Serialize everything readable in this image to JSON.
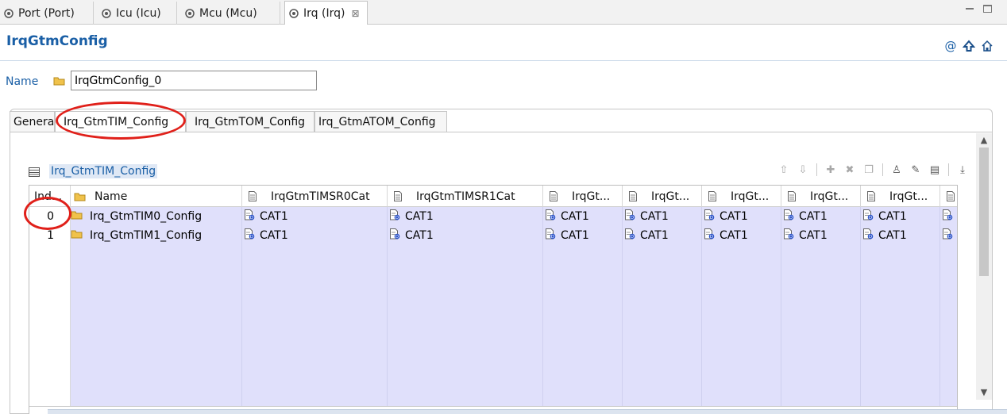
{
  "editor_tabs": [
    {
      "label": "Port (Port)",
      "active": false
    },
    {
      "label": "Icu (Icu)",
      "active": false
    },
    {
      "label": "Mcu (Mcu)",
      "active": false
    },
    {
      "label": "Irq (Irq)",
      "active": true,
      "close": "⊠"
    }
  ],
  "header": {
    "title": "IrqGtmConfig"
  },
  "name_row": {
    "label": "Name",
    "value": "IrqGtmConfig_0"
  },
  "inner_tabs": [
    {
      "label": "Genera",
      "active": false
    },
    {
      "label": "Irq_GtmTIM_Config",
      "active": true
    },
    {
      "label": "Irq_GtmTOM_Config",
      "active": false
    },
    {
      "label": "Irq_GtmATOM_Config",
      "active": false
    }
  ],
  "section": {
    "title": "Irq_GtmTIM_Config"
  },
  "table": {
    "columns": [
      "Ind...",
      "Name",
      "IrqGtmTIMSR0Cat",
      "IrqGtmTIMSR1Cat",
      "IrqGt...",
      "IrqGt...",
      "IrqGt...",
      "IrqGt...",
      "IrqGt..."
    ],
    "rows": [
      {
        "index": "0",
        "name": "Irq_GtmTIM0_Config",
        "values": [
          "CAT1",
          "CAT1",
          "CAT1",
          "CAT1",
          "CAT1",
          "CAT1",
          "CAT1"
        ]
      },
      {
        "index": "1",
        "name": "Irq_GtmTIM1_Config",
        "values": [
          "CAT1",
          "CAT1",
          "CAT1",
          "CAT1",
          "CAT1",
          "CAT1",
          "CAT1"
        ]
      }
    ]
  },
  "colors": {
    "accent": "#1a5fa6",
    "row_selection": "#e0e0fb",
    "annotation": "#e0201a"
  }
}
